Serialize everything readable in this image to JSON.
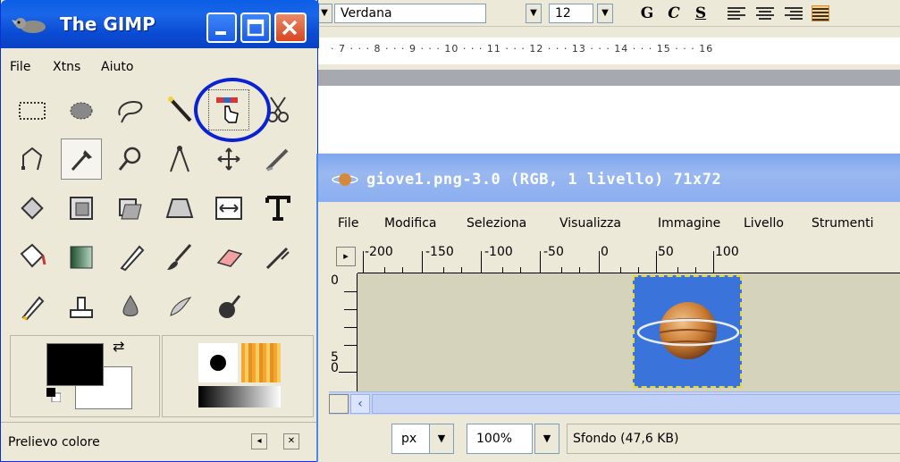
{
  "word_processor": {
    "font_name": "Verdana",
    "font_size": "12",
    "bold_label": "G",
    "italic_label": "C",
    "underline_label": "S",
    "ruler_text": "· 7 · · · 8 · · · 9 · · · 10 · · · 11 · · · 12 · · · 13 · · · 14 · · · 15 · · · 16"
  },
  "toolbox": {
    "title": "The GIMP",
    "menu": {
      "file": "File",
      "xtns": "Xtns",
      "help": "Aiuto"
    },
    "status_text": "Prelievo colore",
    "tools": [
      "rect-select-icon",
      "ellipse-select-icon",
      "lasso-icon",
      "magic-wand-icon",
      "select-by-color-icon",
      "scissors-icon",
      "paths-icon",
      "color-picker-icon",
      "zoom-icon",
      "measure-icon",
      "move-icon",
      "crop-icon",
      "rotate-icon",
      "scale-icon",
      "shear-icon",
      "perspective-icon",
      "flip-icon",
      "text-icon",
      "bucket-fill-icon",
      "blend-icon",
      "pencil-icon",
      "paintbrush-icon",
      "eraser-icon",
      "airbrush-icon",
      "ink-icon",
      "clone-icon",
      "blur-icon",
      "smudge-icon",
      "dodge-burn-icon"
    ],
    "active_tool": "select-by-color-icon",
    "colors": {
      "foreground": "#000000",
      "background": "#ffffff"
    }
  },
  "image_window": {
    "title": "giove1.png-3.0 (RGB, 1 livello) 71x72",
    "menu": [
      "File",
      "Modifica",
      "Seleziona",
      "Visualizza",
      "Immagine",
      "Livello",
      "Strumenti"
    ],
    "hruler_labels": [
      "-200",
      "-150",
      "-100",
      "-50",
      "0",
      "50",
      "100"
    ],
    "vruler_labels": [
      "0",
      "5",
      "0"
    ],
    "unit": "px",
    "zoom": "100%",
    "layer_status": "Sfondo (47,6 KB)",
    "canvas_bg": "#3a73d9"
  }
}
